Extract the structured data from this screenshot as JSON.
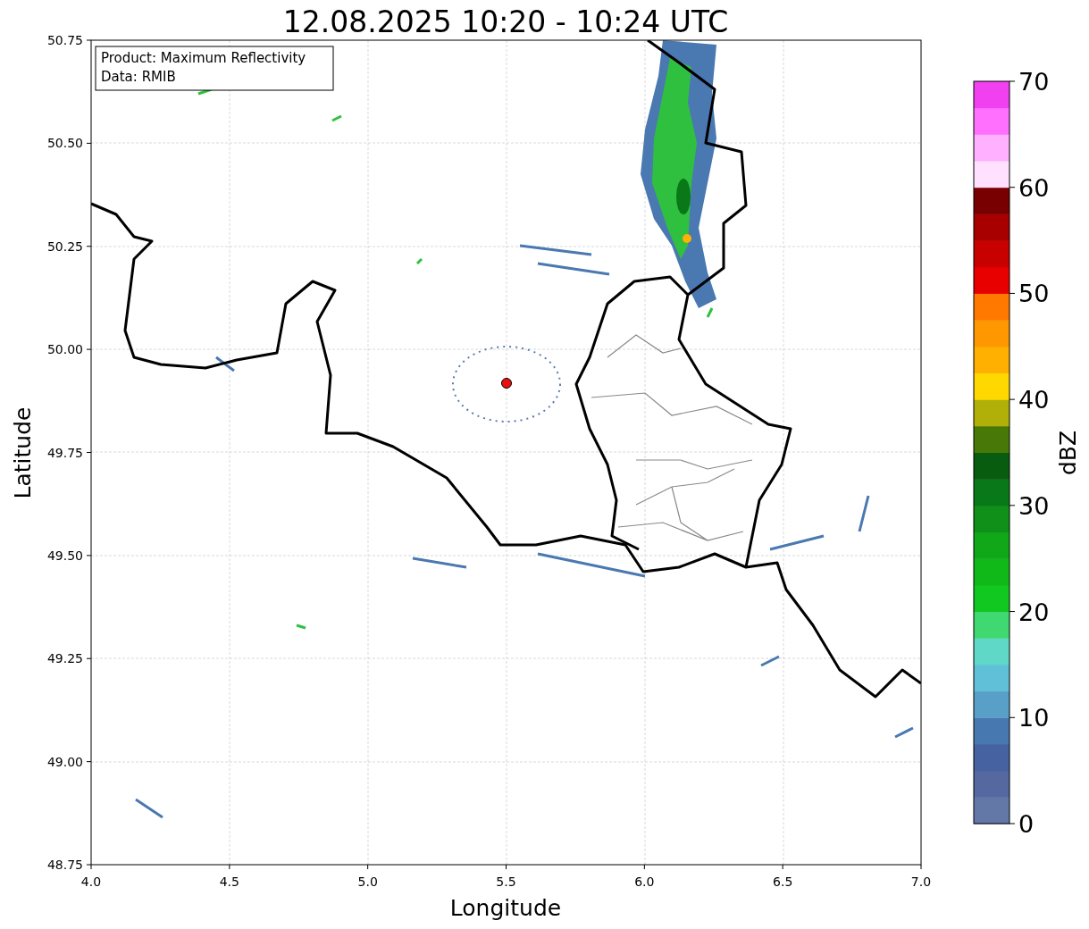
{
  "title": "12.08.2025 10:20 - 10:24 UTC",
  "annotations": [
    "Product: Maximum Reflectivity",
    "Data: RMIB"
  ],
  "xlabel": "Longitude",
  "ylabel": "Latitude",
  "xticks": [
    "4.0",
    "4.5",
    "5.0",
    "5.5",
    "6.0",
    "6.5",
    "7.0"
  ],
  "yticks": [
    "50.75",
    "50.50",
    "50.25",
    "50.00",
    "49.75",
    "49.50",
    "49.25",
    "49.00",
    "48.75"
  ],
  "colorbar": {
    "label": "dBZ",
    "ticks": [
      "70",
      "60",
      "50",
      "40",
      "30",
      "20",
      "10",
      "0"
    ],
    "segments": [
      {
        "color": "#6478a8"
      },
      {
        "color": "#5568a0"
      },
      {
        "color": "#4662a0"
      },
      {
        "color": "#4878b0"
      },
      {
        "color": "#58a0c8"
      },
      {
        "color": "#60c0d8"
      },
      {
        "color": "#60d8c8"
      },
      {
        "color": "#40d870"
      },
      {
        "color": "#10c820"
      },
      {
        "color": "#10b818"
      },
      {
        "color": "#10a818"
      },
      {
        "color": "#109018"
      },
      {
        "color": "#087818"
      },
      {
        "color": "#085c10"
      },
      {
        "color": "#487808"
      },
      {
        "color": "#b0b008"
      },
      {
        "color": "#ffd800"
      },
      {
        "color": "#ffb000"
      },
      {
        "color": "#ff9800"
      },
      {
        "color": "#ff7800"
      },
      {
        "color": "#e80000"
      },
      {
        "color": "#c80000"
      },
      {
        "color": "#a80000"
      },
      {
        "color": "#780000"
      },
      {
        "color": "#ffe0ff"
      },
      {
        "color": "#ffb0ff"
      },
      {
        "color": "#ff70ff"
      },
      {
        "color": "#f040f0"
      }
    ]
  }
}
